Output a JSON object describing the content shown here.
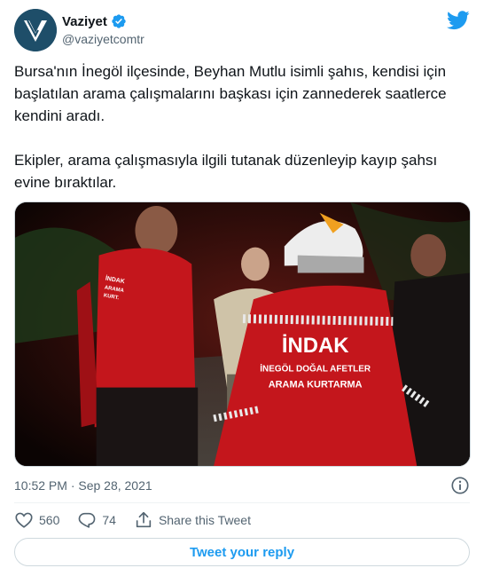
{
  "account": {
    "display_name": "Vaziyet",
    "handle": "@vaziyetcomtr",
    "verified": true
  },
  "tweet": {
    "paragraphs": [
      "Bursa'nın İnegöl ilçesinde, Beyhan Mutlu isimli şahıs, kendisi için başlatılan arama çalışmalarını başkası için zannederek saatlerce kendini aradı.",
      "Ekipler, arama çalışmasıyla ilgili tutanak düzenleyip kayıp şahsı evine bıraktılar."
    ],
    "timestamp": "10:52 PM · Sep 28, 2021"
  },
  "photo": {
    "jacket_title": "İNDAK",
    "jacket_subtitle_1": "İNEGÖL DOĞAL AFETLER",
    "jacket_subtitle_2": "ARAMA KURTARMA",
    "left_jacket_lines": [
      "İNDAK",
      "ARAMA",
      "KURT."
    ]
  },
  "actions": {
    "like_count": "560",
    "reply_count": "74",
    "share_label": "Share this Tweet"
  },
  "reply_button": "Tweet your reply",
  "colors": {
    "brand_blue": "#1d9bf0",
    "text_secondary": "#536471",
    "avatar_bg": "#1e4e69",
    "jacket_red": "#c4161c"
  },
  "icons": [
    "verified-badge-icon",
    "twitter-bird-icon",
    "info-icon",
    "heart-icon",
    "comment-bubble-icon",
    "share-icon"
  ]
}
